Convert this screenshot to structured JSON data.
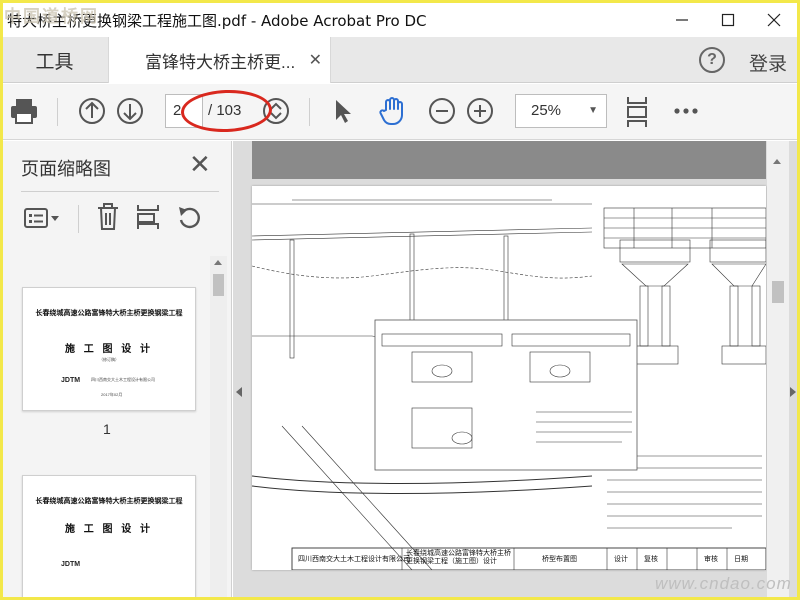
{
  "window": {
    "title": "特大桥主桥更换钢梁工程施工图.pdf - Adobe Acrobat Pro DC",
    "watermark": "中国道桥网"
  },
  "tabs": {
    "tools_label": "工具",
    "doc_tab_label": "富锋特大桥主桥更...",
    "login_label": "登录"
  },
  "toolbar": {
    "current_page": "2",
    "page_total": "/ 103",
    "zoom_value": "25%"
  },
  "sidebar": {
    "title": "页面缩略图",
    "thumb1": {
      "title": "长春绕城高速公路富锋特大桥主桥更换钢梁工程",
      "subtitle": "施 工 图 设 计",
      "note": "（修订稿）",
      "logo": "JDTM",
      "company": "四川西南交大土木工程设计有限公司",
      "date": "2017年02月",
      "page_label": "1"
    },
    "thumb2": {
      "title": "长春绕城高速公路富锋特大桥主桥更换钢梁工程",
      "subtitle": "施 工 图 设 计",
      "logo": "JDTM"
    }
  },
  "document": {
    "titleblock": {
      "company": "四川西南交大土木工程设计有限公司",
      "project": "长春绕城高速公路富锋特大桥主桥更换钢梁工程（施工图）设计",
      "drawing": "桥型布置图",
      "design": "设计",
      "review": "复核",
      "approve": "审核",
      "date": "日期"
    },
    "site_watermark": "www.cndao.com"
  },
  "colors": {
    "accent_blue": "#2d6fd2",
    "annotation_red": "#d9281e",
    "frame_yellow": "#f3e84a"
  }
}
